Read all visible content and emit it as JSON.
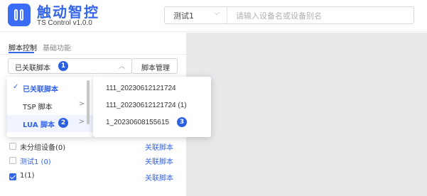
{
  "header": {
    "brand_title": "触动智控",
    "brand_subtitle": "TS Control v1.0.0",
    "group_select_value": "测试1",
    "search_placeholder": "请输入设备名或设备别名"
  },
  "tabs": [
    {
      "label": "脚本控制",
      "active": true
    },
    {
      "label": "基础功能",
      "active": false
    }
  ],
  "script_select": {
    "value": "已关联脚本"
  },
  "manage_button": "脚本管理",
  "dropdown": {
    "items": [
      {
        "label": "已关联脚本",
        "check": "✓",
        "selected": true
      },
      {
        "label": "TSP 脚本",
        "chevron": ">"
      },
      {
        "label": "LUA 脚本",
        "chevron": ">",
        "selected": true
      }
    ]
  },
  "submenu": {
    "items": [
      "111_20230612121724",
      "111_20230612121724 (1)",
      "1_20230608155615"
    ]
  },
  "badges": [
    "1",
    "2",
    "3"
  ],
  "device_list": [
    {
      "name": "未分组设备(0)",
      "action": "关联脚本",
      "checked": false,
      "highlight": false
    },
    {
      "name": "测试1 (0)",
      "action": "关联脚本",
      "checked": false,
      "highlight": true
    },
    {
      "name": "1(1)",
      "action": "关联脚本",
      "checked": true,
      "highlight": false
    }
  ],
  "colors": {
    "accent": "#3565e8",
    "badge": "#2c5fe0",
    "content_bg": "#e8e8ea"
  }
}
